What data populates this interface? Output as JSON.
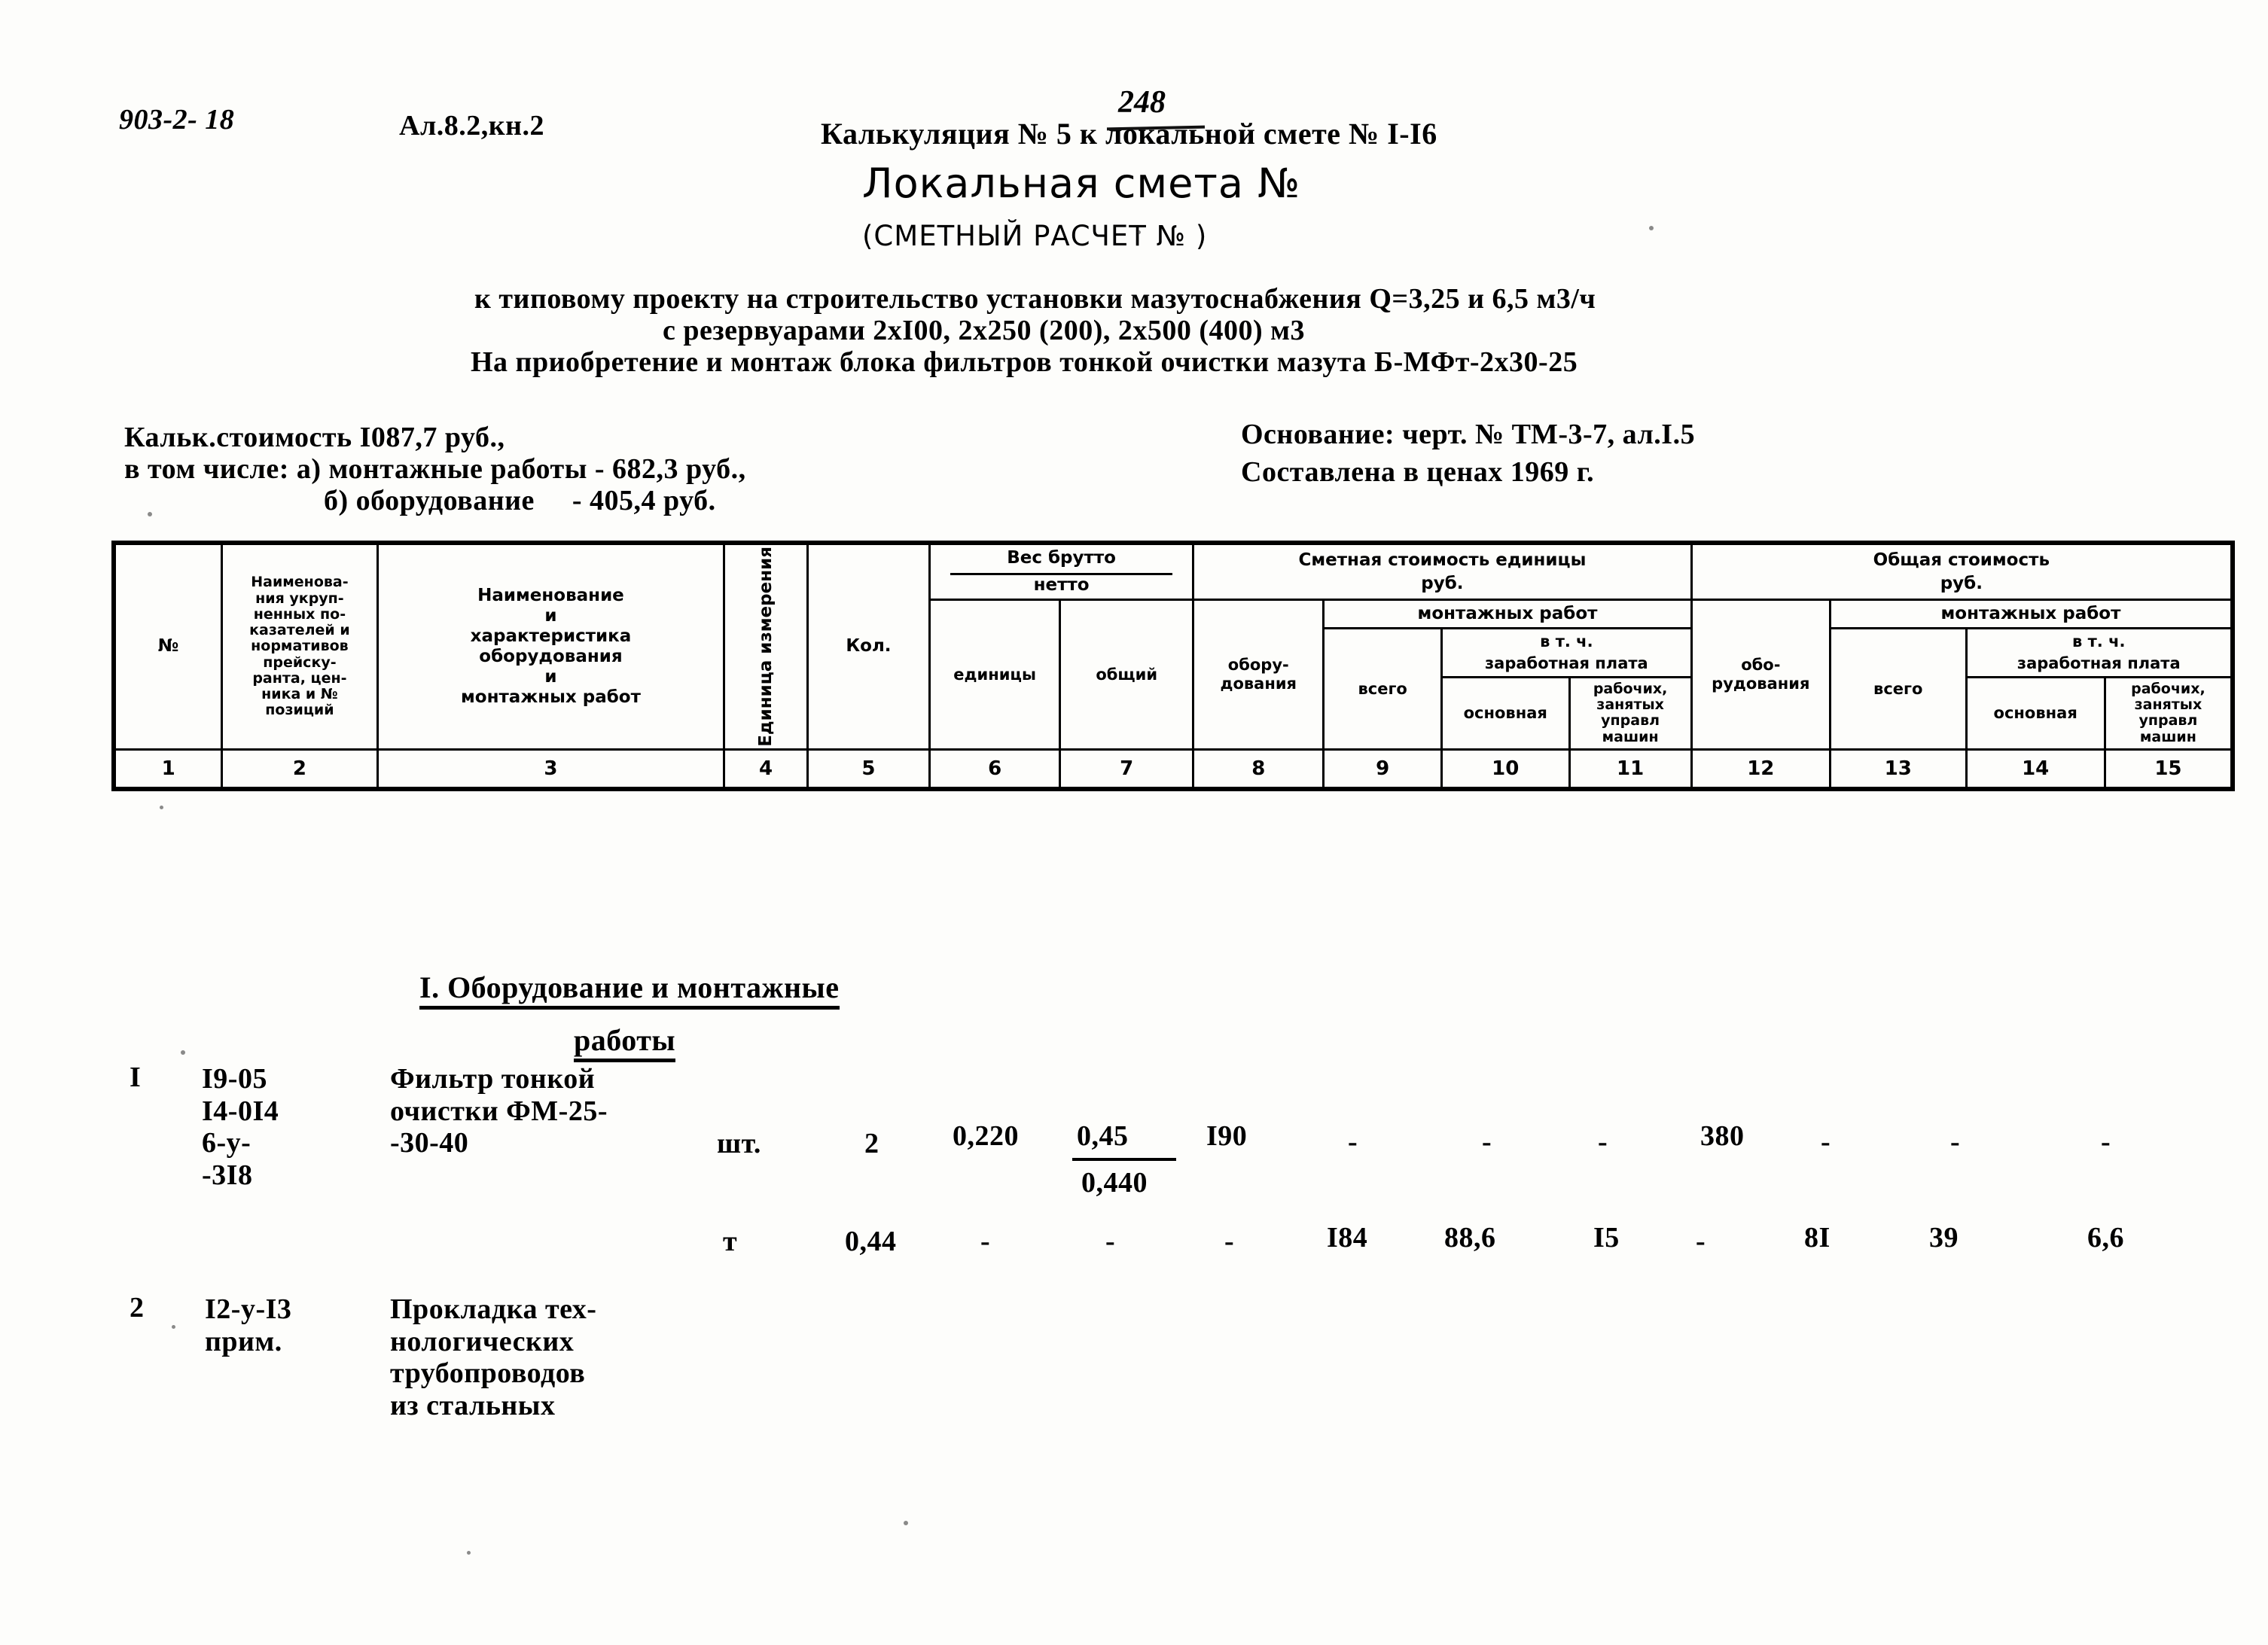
{
  "header": {
    "doc_code": "903-2- 18",
    "album_code": "Ал.8.2,кн.2",
    "calc_line": "Калькуляция № 5 к локальной смете № I-I6",
    "handwritten_number": "248",
    "title_main": "Локальная смета №",
    "title_sub": "(СМЕТНЫЙ РАСЧЕТ №          )",
    "desc_line1": "к типовому проекту на строительство установки мазутоснабжения Q=3,25 и 6,5 м3/ч",
    "desc_line2": "с резервуарами 2хI00, 2х250 (200), 2х500 (400) м3",
    "desc_line3": "На приобретение и монтаж блока фильтров тонкой очистки мазута Б-МФт-2х30-25"
  },
  "summary": {
    "calc_cost": "Кальк.стоимость I087,7 руб.,",
    "breakdown_a": "в том числе: а) монтажные работы - 682,3 руб.,",
    "breakdown_b": "б) оборудование     - 405,4 руб.",
    "basis": "Основание: черт. № ТМ-3-7, ал.I.5",
    "prices_year": "Составлена в ценах 1969 г."
  },
  "table": {
    "group_headers": {
      "ves_brutto": "Вес брутто",
      "netto": "нетто",
      "smetnaya_stoimost_edinicy": "Сметная стоимость единицы",
      "smetnaya_rub": "руб.",
      "obshaya_stoimost": "Общая стоимость",
      "obshaya_rub": "руб.",
      "montazhnyh_rabot_1": "монтажных работ",
      "montazhnyh_rabot_2": "монтажных работ",
      "v_tch_1": "в т. ч.",
      "zarplata_1": "заработная плата",
      "v_tch_2": "в т. ч.",
      "zarplata_2": "заработная плата"
    },
    "columns": [
      {
        "num": "1",
        "label": "№"
      },
      {
        "num": "2",
        "label": "Наименова-\nния  укруп-\nненных по-\nказателей и\nнормативов\nпрейску-\nранта, цен-\nника и №\nпозиций"
      },
      {
        "num": "3",
        "label": "Наименование\nи\nхарактеристика\nоборудования\nи\nмонтажных работ"
      },
      {
        "num": "4",
        "label": "Единица измерения"
      },
      {
        "num": "5",
        "label": "Кол."
      },
      {
        "num": "6",
        "label": "единицы"
      },
      {
        "num": "7",
        "label": "общий"
      },
      {
        "num": "8",
        "label": "обору-\nдования"
      },
      {
        "num": "9",
        "label": "всего"
      },
      {
        "num": "10",
        "label": "основная"
      },
      {
        "num": "11",
        "label": "рабочих,\nзанятых\nуправл\nмашин"
      },
      {
        "num": "12",
        "label": "обо-\nрудования"
      },
      {
        "num": "13",
        "label": "всего"
      },
      {
        "num": "14",
        "label": "основная"
      },
      {
        "num": "15",
        "label": "рабочих,\nзанятых\nуправл\nмашин"
      }
    ]
  },
  "body": {
    "section_title_line1": "I. Оборудование и монтажные",
    "section_title_line2": "работы",
    "rows": [
      {
        "num": "I",
        "code": "I9-05\nI4-0I4\n6-у-\n-3I8",
        "name": "Фильтр тонкой\nочистки ФМ-25-\n-30-40",
        "unit": "шт.",
        "qty": "2",
        "c6": "0,220",
        "c7_top": "0,45",
        "c7_bottom": "0,440",
        "c8": "I90",
        "c9": "-",
        "c10": "-",
        "c11": "-",
        "c12": "380",
        "c13": "-",
        "c14": "-",
        "c15": "-"
      },
      {
        "num": "",
        "code": "",
        "name": "",
        "unit": "т",
        "qty": "0,44",
        "c6": "-",
        "c7_top": "-",
        "c7_bottom": "",
        "c8": "-",
        "c9": "I84",
        "c10": "88,6",
        "c11": "I5",
        "c12": "-",
        "c13": "8I",
        "c14": "39",
        "c15": "6,6"
      },
      {
        "num": "2",
        "code": "I2-у-I3\nприм.",
        "name": "Прокладка тех-\nнологических\nтрубопроводов\nиз стальных",
        "unit": "",
        "qty": "",
        "c6": "",
        "c7_top": "",
        "c7_bottom": "",
        "c8": "",
        "c9": "",
        "c10": "",
        "c11": "",
        "c12": "",
        "c13": "",
        "c14": "",
        "c15": ""
      }
    ]
  }
}
